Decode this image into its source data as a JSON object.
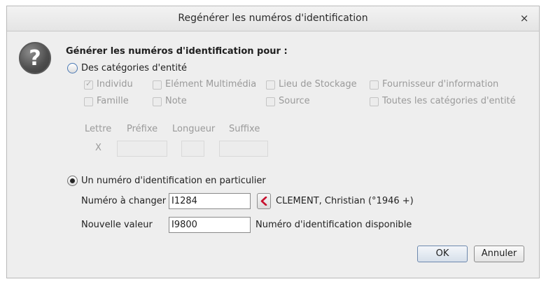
{
  "dialog": {
    "title": "Regénérer les numéros d'identification",
    "close_glyph": "×",
    "heading": "Générer les numéros d'identification pour :"
  },
  "icons": {
    "question": "?"
  },
  "option_categories": {
    "label": "Des catégories d'entité",
    "selected": false,
    "checkboxes": [
      {
        "label": "Individu",
        "checked": true
      },
      {
        "label": "Elément Multimédia",
        "checked": false
      },
      {
        "label": "Lieu de Stockage",
        "checked": false
      },
      {
        "label": "Fournisseur d'information",
        "checked": false
      },
      {
        "label": "Famille",
        "checked": false
      },
      {
        "label": "Note",
        "checked": false
      },
      {
        "label": "Source",
        "checked": false
      },
      {
        "label": "Toutes les catégories d'entité",
        "checked": false
      }
    ],
    "format": {
      "headers": {
        "letter": "Lettre",
        "prefix": "Préfixe",
        "length": "Longueur",
        "suffix": "Suffixe"
      },
      "letter_value": "X",
      "prefix_value": "",
      "length_value": "",
      "suffix_value": ""
    }
  },
  "option_single": {
    "label": "Un numéro d'identification en particulier",
    "selected": true,
    "change_label": "Numéro à changer",
    "change_value": "I1284",
    "change_entity": "CLEMENT, Christian (°1946 +)",
    "new_label": "Nouvelle valeur",
    "new_value": "I9800",
    "new_status": "Numéro d'identification disponible"
  },
  "buttons": {
    "ok": "OK",
    "cancel": "Annuler"
  }
}
